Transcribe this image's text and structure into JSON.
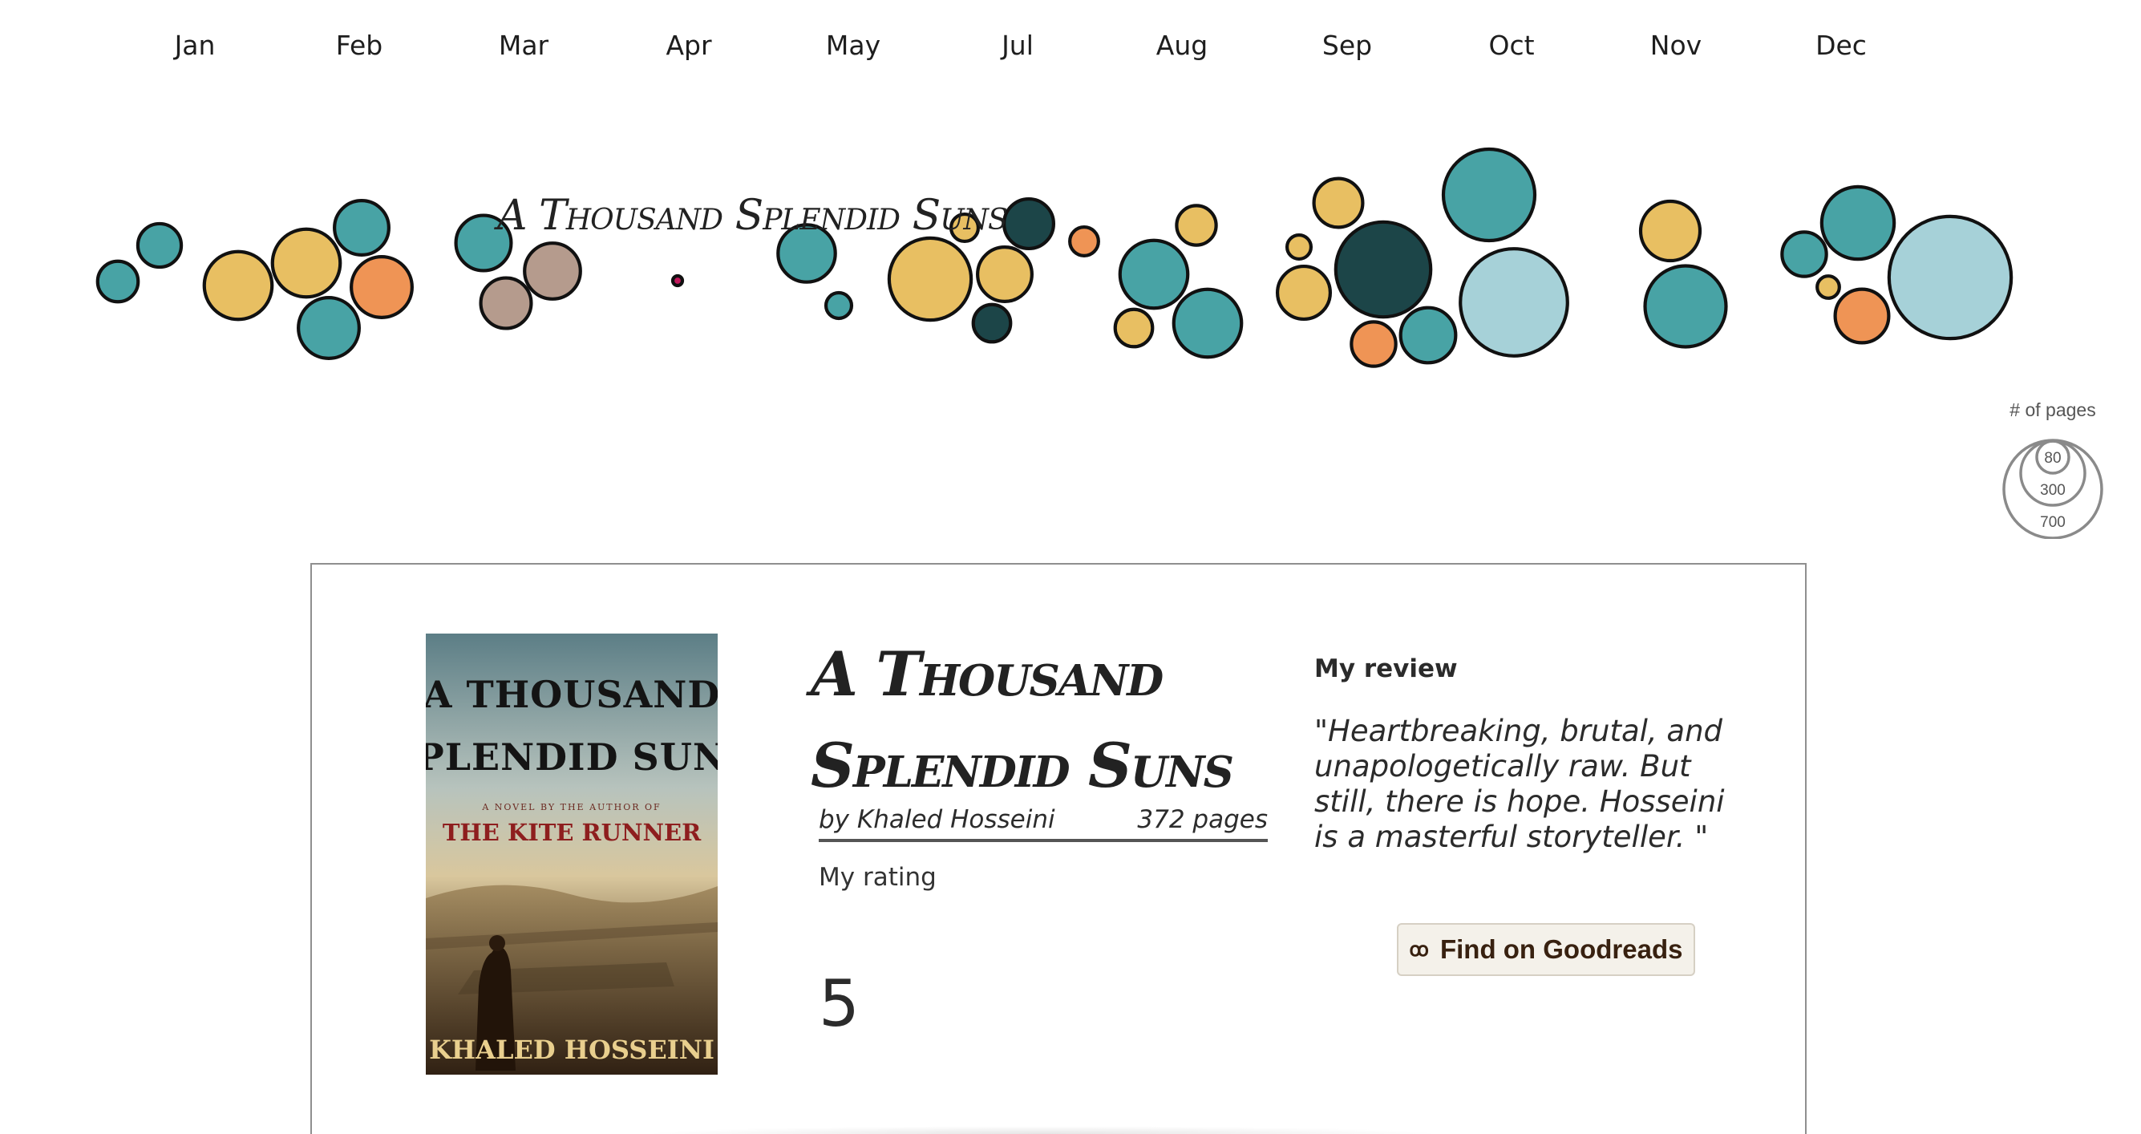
{
  "chart_data": {
    "type": "bubble",
    "months": [
      "Jan",
      "Feb",
      "Mar",
      "Apr",
      "May",
      "Jul",
      "Aug",
      "Sep",
      "Oct",
      "Nov",
      "Dec"
    ],
    "size_variable": "# of pages",
    "rating_colors": {
      "1": "#c2185b",
      "2": "#ef9455",
      "3": "#e8bf62",
      "4": "#48a3a5",
      "5": "#1c4548",
      "other": "#a6d1d8",
      "muted": "#b59b8d"
    },
    "highlighted_book": "A Thousand Splendid Suns",
    "books": [
      {
        "month": "Jan",
        "pages": 230,
        "rating": 4
      },
      {
        "month": "Jan",
        "pages": 200,
        "rating": 4
      },
      {
        "month": "Jan",
        "pages": 560,
        "rating": 3
      },
      {
        "month": "Feb",
        "pages": 560,
        "rating": 3
      },
      {
        "month": "Feb",
        "pages": 360,
        "rating": 4
      },
      {
        "month": "Feb",
        "pages": 450,
        "rating": 2
      },
      {
        "month": "Feb",
        "pages": 450,
        "rating": 4
      },
      {
        "month": "Mar",
        "pages": 372,
        "rating": 4
      },
      {
        "month": "Mar",
        "pages": 380,
        "rating": "muted"
      },
      {
        "month": "Mar",
        "pages": 310,
        "rating": "muted"
      },
      {
        "month": "Apr",
        "pages": 10,
        "rating": 1
      },
      {
        "month": "May",
        "pages": 400,
        "rating": 4
      },
      {
        "month": "May",
        "pages": 80,
        "rating": 4
      },
      {
        "month": "Jul",
        "pages": 90,
        "rating": 3
      },
      {
        "month": "Jul",
        "pages": 820,
        "rating": 3
      },
      {
        "month": "Jul",
        "pages": 360,
        "rating": 3
      },
      {
        "month": "Jul",
        "pages": 300,
        "rating": 5
      },
      {
        "month": "Jul",
        "pages": 170,
        "rating": 5
      },
      {
        "month": "Aug",
        "pages": 100,
        "rating": 2
      },
      {
        "month": "Aug",
        "pages": 560,
        "rating": 4
      },
      {
        "month": "Aug",
        "pages": 190,
        "rating": 3
      },
      {
        "month": "Aug",
        "pages": 170,
        "rating": 3
      },
      {
        "month": "Aug",
        "pages": 560,
        "rating": 4
      },
      {
        "month": "Sep",
        "pages": 290,
        "rating": 3
      },
      {
        "month": "Sep",
        "pages": 70,
        "rating": 3
      },
      {
        "month": "Sep",
        "pages": 340,
        "rating": 3
      },
      {
        "month": "Sep",
        "pages": 1100,
        "rating": 5
      },
      {
        "month": "Sep",
        "pages": 240,
        "rating": 2
      },
      {
        "month": "Oct",
        "pages": 1020,
        "rating": 4
      },
      {
        "month": "Oct",
        "pages": 1400,
        "rating": "other"
      },
      {
        "month": "Oct",
        "pages": 370,
        "rating": 4
      },
      {
        "month": "Nov",
        "pages": 430,
        "rating": 3
      },
      {
        "month": "Nov",
        "pages": 800,
        "rating": 4
      },
      {
        "month": "Dec",
        "pages": 240,
        "rating": 4
      },
      {
        "month": "Dec",
        "pages": 60,
        "rating": 3
      },
      {
        "month": "Dec",
        "pages": 640,
        "rating": 4
      },
      {
        "month": "Dec",
        "pages": 350,
        "rating": 2
      },
      {
        "month": "Dec",
        "pages": 1820,
        "rating": "other"
      }
    ]
  },
  "legend": {
    "title": "# of pages",
    "values": [
      "80",
      "300",
      "700"
    ]
  },
  "card": {
    "title": "A Thousand Splendid Suns",
    "author_line": "by Khaled Hosseini",
    "pages_line": "372 pages",
    "rating_label": "My rating",
    "rating_value": "5",
    "review_heading": "My review",
    "review_text": "\"Heartbreaking, brutal, and unapologetically raw. But still, there is hope. Hosseini is a masterful storyteller. \"",
    "button_icon": "goodreads-icon",
    "button_label": "Find on Goodreads"
  },
  "cover": {
    "title_line_1": "A THOUSAND",
    "title_line_2": "SPLENDID SUNS",
    "tagline": "A NOVEL BY THE AUTHOR OF",
    "subtitle": "THE KITE RUNNER",
    "author": "KHALED HOSSEINI"
  }
}
